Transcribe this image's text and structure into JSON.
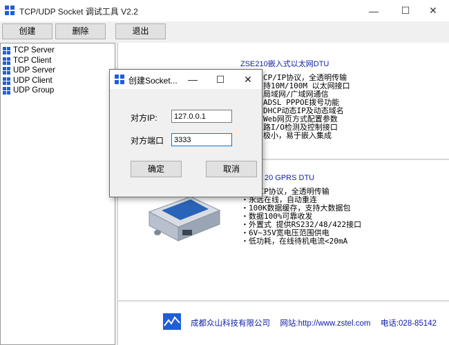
{
  "window": {
    "title": "TCP/UDP Socket 调试工具 V2.2",
    "minimize_glyph": "—",
    "maximize_glyph": "☐",
    "close_glyph": "✕"
  },
  "toolbar": {
    "create_label": "创建",
    "delete_label": "删除",
    "exit_label": "退出"
  },
  "tree": {
    "items": [
      {
        "label": "TCP Server",
        "icon": "grid-icon"
      },
      {
        "label": "TCP Client",
        "icon": "grid-icon"
      },
      {
        "label": "UDP Server",
        "icon": "grid-icon"
      },
      {
        "label": "UDP Client",
        "icon": "grid-icon"
      },
      {
        "label": "UDP Group",
        "icon": "grid-icon"
      }
    ]
  },
  "banner": {
    "product1": {
      "title": "ZSE210嵌入式以太网DTU",
      "features": [
        "CP/IP协议，全透明传输",
        "持10M/100M 以太网接口",
        "局域网/广域网通信",
        "ADSL PPPOE拨号功能",
        "DHCP动态IP及动态域名",
        "Web网页方式配置参数",
        "路I/O检测及控制接口",
        "极小，易于嵌入集成"
      ]
    },
    "product2": {
      "title": "20 GPRS DTU",
      "features": [
        "TCP/IP协议，全透明传输",
        "・永远在线，自动重连",
        "・100K数据缓存，支持大数据包",
        "・数据100%可靠收发",
        "・外置式 提供RS232/48/422接口",
        "・6V~35V宽电压范围供电",
        "・低功耗，在线待机电流<20mA"
      ]
    },
    "footer": {
      "company": "成都众山科技有限公司",
      "website_label": "网站:",
      "website": "http://www.zstel.com",
      "phone_label": "电话:",
      "phone": "028-85142"
    }
  },
  "dialog": {
    "title": "创建Socket...",
    "ip_label": "对方IP:",
    "ip_value": "127.0.0.1",
    "port_label": "对方端口",
    "port_value": "3333",
    "ok_label": "确定",
    "cancel_label": "取消"
  },
  "colors": {
    "accent": "#0078d7",
    "link_blue": "#1020a8",
    "icon_blue": "#1f5fd6"
  }
}
